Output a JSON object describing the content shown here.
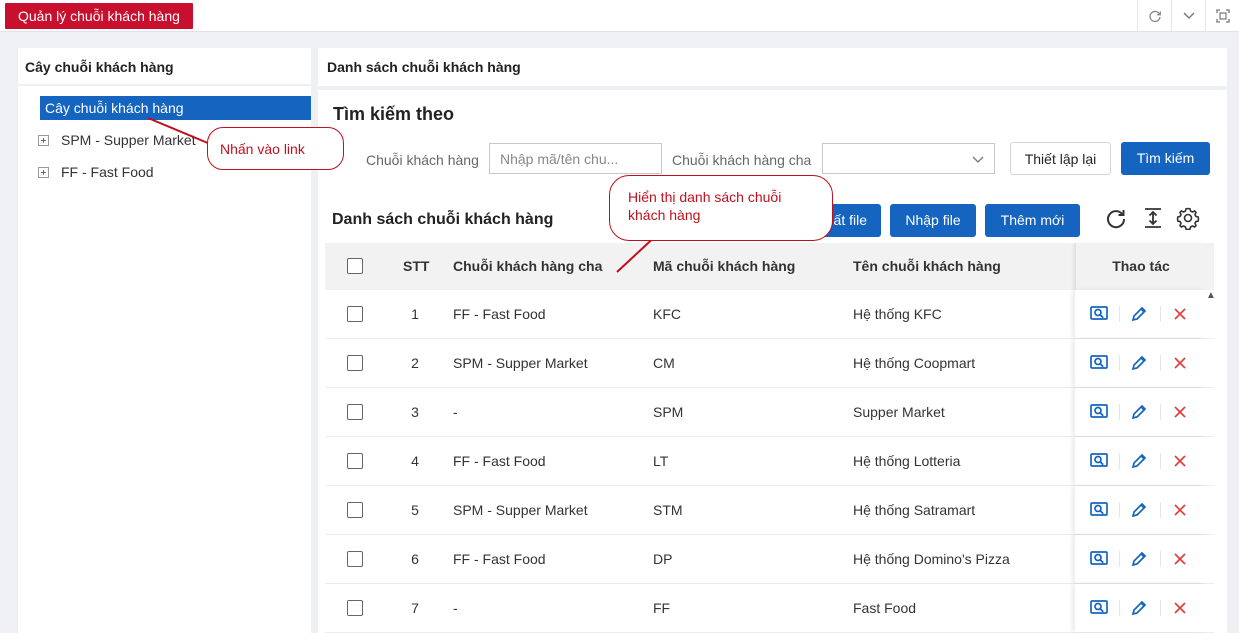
{
  "module_tab": "Quản lý chuỗi khách hàng",
  "left_panel": {
    "title": "Cây chuỗi khách hàng",
    "tree": {
      "root": "Cây chuỗi khách hàng",
      "items": [
        "SPM - Supper Market",
        "FF - Fast Food"
      ]
    }
  },
  "right_panel": {
    "title": "Danh sách chuỗi khách hàng",
    "search": {
      "title": "Tìm kiếm theo",
      "chain_label": "Chuỗi khách hàng",
      "chain_placeholder": "Nhập mã/tên chu...",
      "parent_label": "Chuỗi khách hàng cha",
      "parent_value": "",
      "reset_label": "Thiết lập lại",
      "search_label": "Tìm kiếm"
    },
    "list": {
      "title": "Danh sách chuỗi khách hàng",
      "export_label": "ất file",
      "import_label": "Nhập file",
      "add_label": "Thêm mới"
    },
    "table": {
      "headers": {
        "stt": "STT",
        "parent": "Chuỗi khách hàng cha",
        "code": "Mã chuỗi khách hàng",
        "name": "Tên chuỗi khách hàng",
        "actions": "Thao tác"
      },
      "rows": [
        {
          "stt": "1",
          "parent": "FF - Fast Food",
          "code": "KFC",
          "name": "Hệ thống KFC"
        },
        {
          "stt": "2",
          "parent": "SPM - Supper Market",
          "code": "CM",
          "name": "Hệ thống Coopmart"
        },
        {
          "stt": "3",
          "parent": "-",
          "code": "SPM",
          "name": "Supper Market"
        },
        {
          "stt": "4",
          "parent": "FF - Fast Food",
          "code": "LT",
          "name": "Hệ thống Lotteria"
        },
        {
          "stt": "5",
          "parent": "SPM - Supper Market",
          "code": "STM",
          "name": "Hệ thống Satramart"
        },
        {
          "stt": "6",
          "parent": "FF - Fast Food",
          "code": "DP",
          "name": "Hệ thống Domino's Pizza"
        },
        {
          "stt": "7",
          "parent": "-",
          "code": "FF",
          "name": "Fast Food"
        }
      ]
    }
  },
  "annotations": {
    "click_link": "Nhấn vào link",
    "show_list": "Hiển thị danh sách chuỗi khách hàng"
  },
  "colors": {
    "brand_red": "#c8102e",
    "primary_blue": "#1565c0",
    "delete_red": "#e53935",
    "callout_red": "#c0101c"
  },
  "icons": {
    "top_actions": [
      "refresh-icon",
      "chevron-down-icon",
      "fullscreen-icon"
    ],
    "toolbar": [
      "refresh-icon",
      "column-height-icon",
      "settings-icon"
    ],
    "row_actions": [
      "view-icon",
      "edit-icon",
      "delete-icon"
    ]
  }
}
